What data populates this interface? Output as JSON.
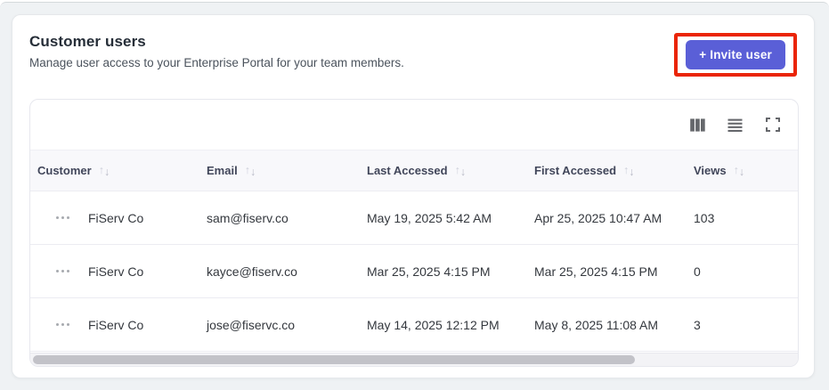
{
  "header": {
    "title": "Customer users",
    "subtitle": "Manage user access to your Enterprise Portal for your team members.",
    "invite_button_label": "+ Invite user"
  },
  "toolbar": {
    "icons": [
      "columns-icon",
      "density-icon",
      "fullscreen-icon"
    ]
  },
  "table": {
    "columns": [
      {
        "label": "Customer",
        "sortable": true
      },
      {
        "label": "Email",
        "sortable": true
      },
      {
        "label": "Last Accessed",
        "sortable": true
      },
      {
        "label": "First Accessed",
        "sortable": true
      },
      {
        "label": "Views",
        "sortable": true
      }
    ],
    "rows": [
      {
        "customer": "FiServ Co",
        "email": "sam@fiserv.co",
        "last_accessed": "May 19, 2025 5:42 AM",
        "first_accessed": "Apr 25, 2025 10:47 AM",
        "views": "103"
      },
      {
        "customer": "FiServ Co",
        "email": "kayce@fiserv.co",
        "last_accessed": "Mar 25, 2025 4:15 PM",
        "first_accessed": "Mar 25, 2025 4:15 PM",
        "views": "0"
      },
      {
        "customer": "FiServ Co",
        "email": "jose@fiservc.co",
        "last_accessed": "May 14, 2025 12:12 PM",
        "first_accessed": "May 8, 2025 11:08 AM",
        "views": "3"
      }
    ]
  },
  "sort_icon_glyphs": {
    "up": "↑",
    "down": "↓"
  },
  "colors": {
    "accent": "#5a5fd7",
    "annotation": "#ea2508"
  }
}
